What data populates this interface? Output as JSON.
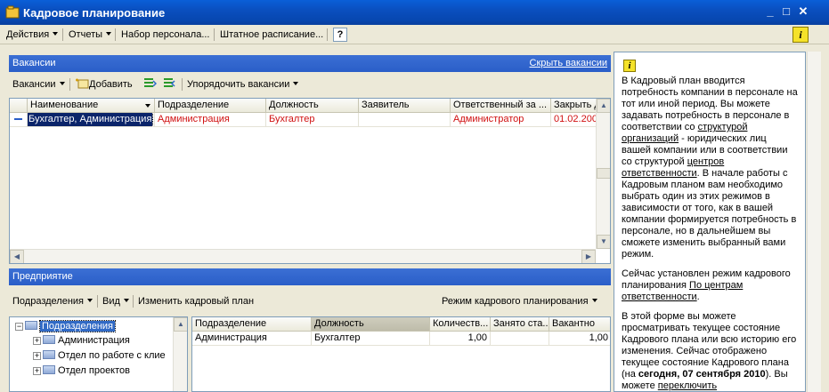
{
  "window": {
    "title": "Кадровое планирование"
  },
  "menu": {
    "actions": "Действия",
    "reports": "Отчеты",
    "recruit": "Набор персонала...",
    "staffing": "Штатное расписание...",
    "help": "?"
  },
  "vacancies": {
    "header": "Вакансии",
    "hide_link": "Скрыть вакансии",
    "toolbar": {
      "menu": "Вакансии",
      "add": "Добавить",
      "sort": "Упорядочить вакансии"
    },
    "columns": [
      "Наименование",
      "Подразделение",
      "Должность",
      "Заявитель",
      "Ответственный за ...",
      "Закрыть д"
    ],
    "rows": [
      {
        "name": "Бухгалтер, Администрация",
        "department": "Администрация",
        "position": "Бухгалтер",
        "applicant": "",
        "responsible": "Администратор",
        "close": "01.02.200"
      }
    ]
  },
  "enterprise": {
    "header": "Предприятие",
    "toolbar": {
      "departments": "Подразделения",
      "view": "Вид",
      "change_plan": "Изменить кадровый план",
      "mode": "Режим кадрового планирования"
    },
    "tree": {
      "root": "Подразделения",
      "items": [
        "Администрация",
        "Отдел по работе с клие",
        "Отдел проектов"
      ]
    },
    "columns": [
      "Подразделение",
      "Должность",
      "Количеств...",
      "Занято ста...",
      "Вакантно"
    ],
    "rows": [
      {
        "department": "Администрация",
        "position": "Бухгалтер",
        "count": "1,00",
        "occupied": "",
        "vacant": "1,00"
      }
    ]
  },
  "info": {
    "p1": "В Кадровый план вводится потребность компании в персонале на тот или иной период. Вы можете задавать потребность в персонале в соответствии со ",
    "p1_link1": "структурой организаций",
    "p1_b": " - юридических лиц вашей компании или в соответствии со структурой ",
    "p1_link2": "центров ответственности",
    "p1_c": ". В начале работы с Кадровым планом вам необходимо выбрать один из этих режимов в зависимости от того, как в вашей компании формируется потребность в персонале, но в дальнейшем вы сможете изменить выбранный вами режим.",
    "p2": "Сейчас установлен режим кадрового планирования ",
    "p2_link": "По центрам ответственности",
    "p2_end": ".",
    "p3": "В этой форме вы можете просматривать текущее состояние Кадрового плана или всю историю его изменения. Сейчас отображено текущее состояние Кадрового плана (на ",
    "p3_b": "сегодня, 07 сентября 2010",
    "p3_c": "). Вы можете ",
    "p3_link": "переключить"
  },
  "colors": {
    "title_bar": "#0a4fbf",
    "section_header": "#2a5ec8",
    "red_text": "#d01010",
    "selection": "#316ac5"
  }
}
